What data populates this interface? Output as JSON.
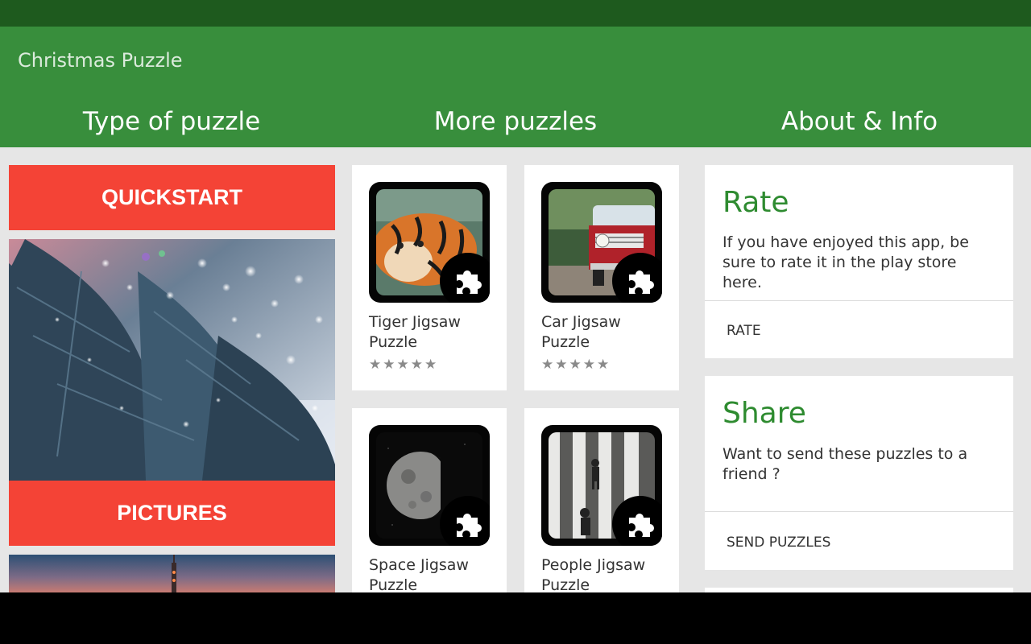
{
  "app": {
    "title": "Christmas Puzzle"
  },
  "tabs": [
    {
      "label": "Type of puzzle"
    },
    {
      "label": "More puzzles"
    },
    {
      "label": "About & Info"
    }
  ],
  "left_column": {
    "quickstart_label": "QUICKSTART",
    "pictures_label": "PICTURES"
  },
  "puzzles": [
    {
      "name": "Tiger Jigsaw Puzzle",
      "stars": "★★★★★",
      "rating_stars": 5
    },
    {
      "name": "Car Jigsaw Puzzle",
      "stars": "★★★★★",
      "rating_stars": 5
    },
    {
      "name": "Space Jigsaw Puzzle"
    },
    {
      "name": "People Jigsaw Puzzle"
    }
  ],
  "info": {
    "rate": {
      "title": "Rate",
      "text": "If you have enjoyed this app, be sure to rate it in the play store here.",
      "action": "RATE"
    },
    "share": {
      "title": "Share",
      "text": "Want to send these puzzles to a friend ?",
      "action": "SEND PUZZLES"
    }
  },
  "colors": {
    "app_bar": "#388e3c",
    "status_bar": "#1e5a1e",
    "accent_red": "#f44336",
    "title_green": "#2e8b30"
  },
  "icons": [
    "puzzle-piece-icon",
    "star-icon"
  ]
}
